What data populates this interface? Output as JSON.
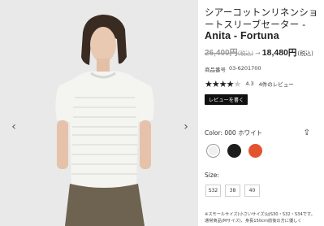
{
  "product": {
    "title_jp": "シアーコットンリネンショートスリーブセーター - ",
    "title_brand": "Anita - Fortuna",
    "old_price": "26,400円",
    "old_price_tax": "(税込)",
    "price_arrow": "→",
    "new_price": "18,480円",
    "new_price_tax": "(税込)",
    "code_label": "商品番号",
    "code_value": "03-6201700",
    "rating_stars_filled": 4,
    "rating_stars_total": 5,
    "rating_score": "4.3",
    "review_count": "4件のレビュー",
    "review_button": "レビューを書く"
  },
  "gallery": {
    "prev_glyph": "‹",
    "next_glyph": "›"
  },
  "color": {
    "label": "Color:",
    "value": "000 ホワイト",
    "share_glyph": "⇪",
    "swatches": [
      {
        "name": "white",
        "color": "#f1f0ee"
      },
      {
        "name": "black",
        "color": "#1c1c1c"
      },
      {
        "name": "orange",
        "color": "#e4532f"
      }
    ]
  },
  "size": {
    "label": "Size:",
    "options": [
      "S32",
      "38",
      "40"
    ]
  },
  "note": {
    "line1": "※スモールサイズ(小さいサイズ)はS30・S32・S34です。",
    "line2": "通常商品(Mサイズ)、身長150cm前後の方に優しく"
  }
}
